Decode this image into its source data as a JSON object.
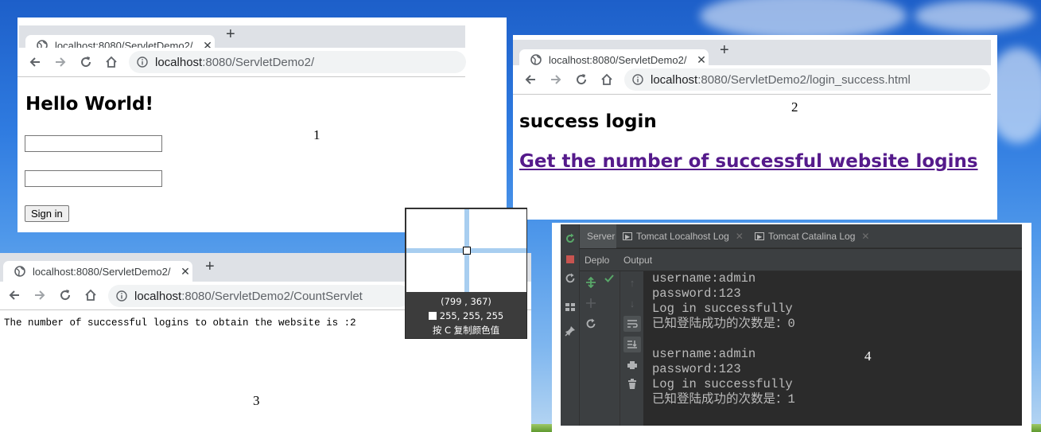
{
  "window1": {
    "tab_title": "localhost:8080/ServletDemo2/",
    "url_host": "localhost",
    "url_path": ":8080/ServletDemo2/",
    "heading": "Hello World!",
    "field1_value": "",
    "field2_value": "",
    "sign_in_label": "Sign in",
    "number_label": "1"
  },
  "window2": {
    "tab_title": "localhost:8080/ServletDemo2/",
    "url_host": "localhost",
    "url_path": ":8080/ServletDemo2/login_success.html",
    "heading": "success login",
    "link_text": "Get the number of successful website logins",
    "number_label": "2"
  },
  "window3": {
    "tab_title": "localhost:8080/ServletDemo2/",
    "url_host": "localhost",
    "url_path": ":8080/ServletDemo2/CountServlet",
    "body_text": "The number of successful logins to obtain the website is :2",
    "number_label": "3"
  },
  "color_picker": {
    "coords": "(799 , 367)",
    "rgb": "255, 255, 255",
    "hint": "按 C 复制颜色值"
  },
  "ide": {
    "tabs": [
      "Server",
      "Tomcat Localhost Log",
      "Tomcat Catalina Log"
    ],
    "sub_tabs": [
      "Deplo",
      "Output"
    ],
    "log_lines": [
      "username:admin",
      "password:123",
      "Log in successfully",
      "已知登陆成功的次数是：0",
      "",
      "username:admin",
      "password:123",
      "Log in successfully",
      "已知登陆成功的次数是：1"
    ],
    "number_label": "4"
  },
  "colors": {
    "link_visited": "#551a8b",
    "ide_background": "#2b2b2b",
    "ide_text": "#bbbbbb"
  }
}
